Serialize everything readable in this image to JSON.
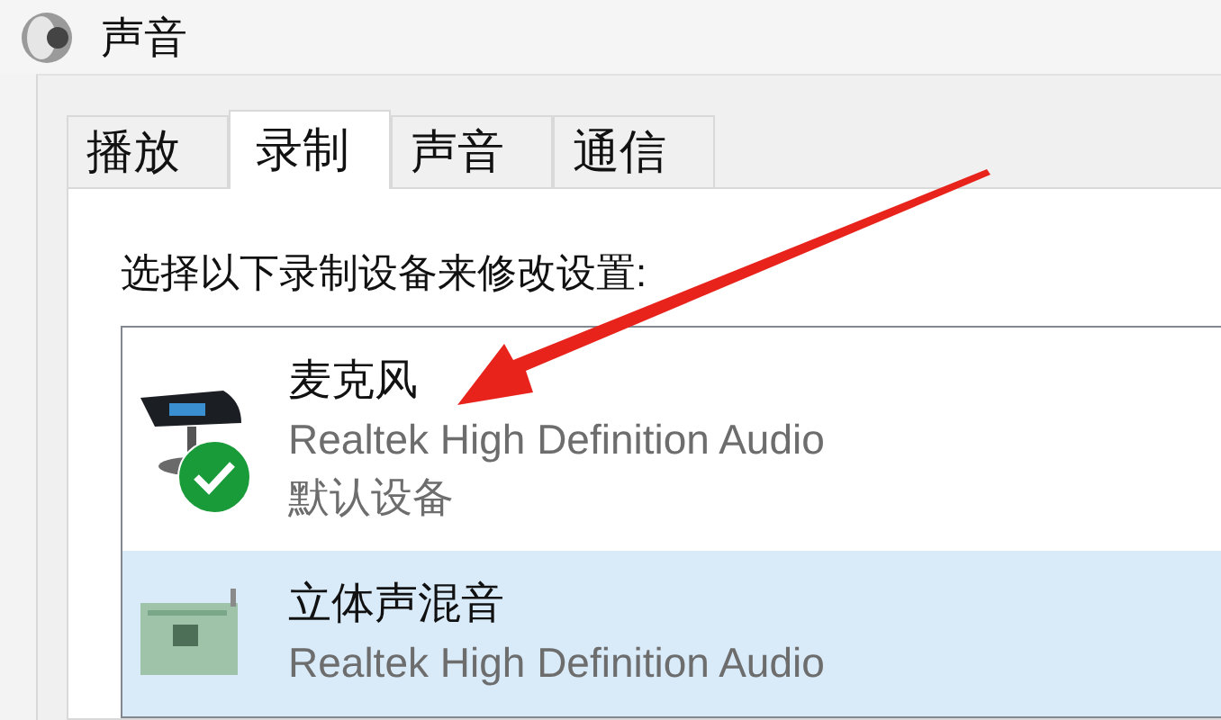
{
  "window": {
    "title": "声音"
  },
  "tabs": [
    {
      "label": "播放",
      "selected": false
    },
    {
      "label": "录制",
      "selected": true
    },
    {
      "label": "声音",
      "selected": false
    },
    {
      "label": "通信",
      "selected": false
    }
  ],
  "instruction": "选择以下录制设备来修改设置:",
  "devices": [
    {
      "name": "麦克风",
      "kind": "microphone",
      "driver": "Realtek High Definition Audio",
      "status": "默认设备",
      "default": true,
      "selected": false
    },
    {
      "name": "立体声混音",
      "kind": "board",
      "driver": "Realtek High Definition Audio",
      "default": false,
      "selected": true
    }
  ]
}
